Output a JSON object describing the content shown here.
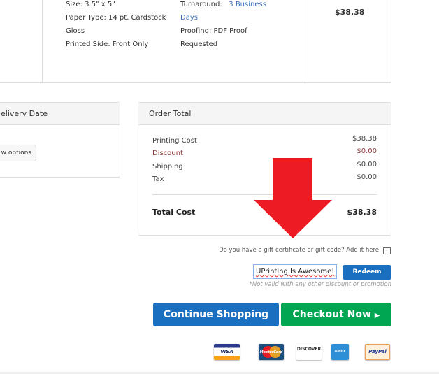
{
  "product_specs": {
    "left": [
      "Size: 3.5\" x 5\"",
      "Paper Type: 14 pt. Cardstock",
      "Gloss",
      "Printed Side: Front Only"
    ],
    "turnaround_label": "Turnaround:",
    "turnaround_value_1": "3 Business",
    "turnaround_value_2": "Days",
    "proofing_1": "Proofing: PDF Proof",
    "proofing_2": "Requested",
    "price": "$38.38"
  },
  "delivery": {
    "title": "elivery Date",
    "button": "w options"
  },
  "order_total": {
    "title": "Order Total",
    "rows": [
      {
        "label": "Printing Cost",
        "value": "$38.38"
      },
      {
        "label": "Discount",
        "value": "$0.00"
      },
      {
        "label": "Shipping",
        "value": "$0.00"
      },
      {
        "label": "Tax",
        "value": "$0.00"
      }
    ],
    "total_label": "Total Cost",
    "total_value": "$38.38"
  },
  "gift": {
    "prompt": "Do you have a gift certificate or gift code? Add it here",
    "input_value": "UPrinting Is Awesome!",
    "redeem": "Redeem",
    "note": "*Not valid with any other discount or promotion"
  },
  "actions": {
    "continue": "Continue Shopping",
    "checkout": "Checkout Now"
  },
  "payment_cards": [
    "VISA",
    "MasterCard",
    "DISCOVER",
    "AMEX",
    "PayPal"
  ],
  "colors": {
    "blue": "#1a6fc0",
    "green": "#00a651",
    "arrow": "#ed1c24",
    "discount": "#8b3a3a"
  }
}
